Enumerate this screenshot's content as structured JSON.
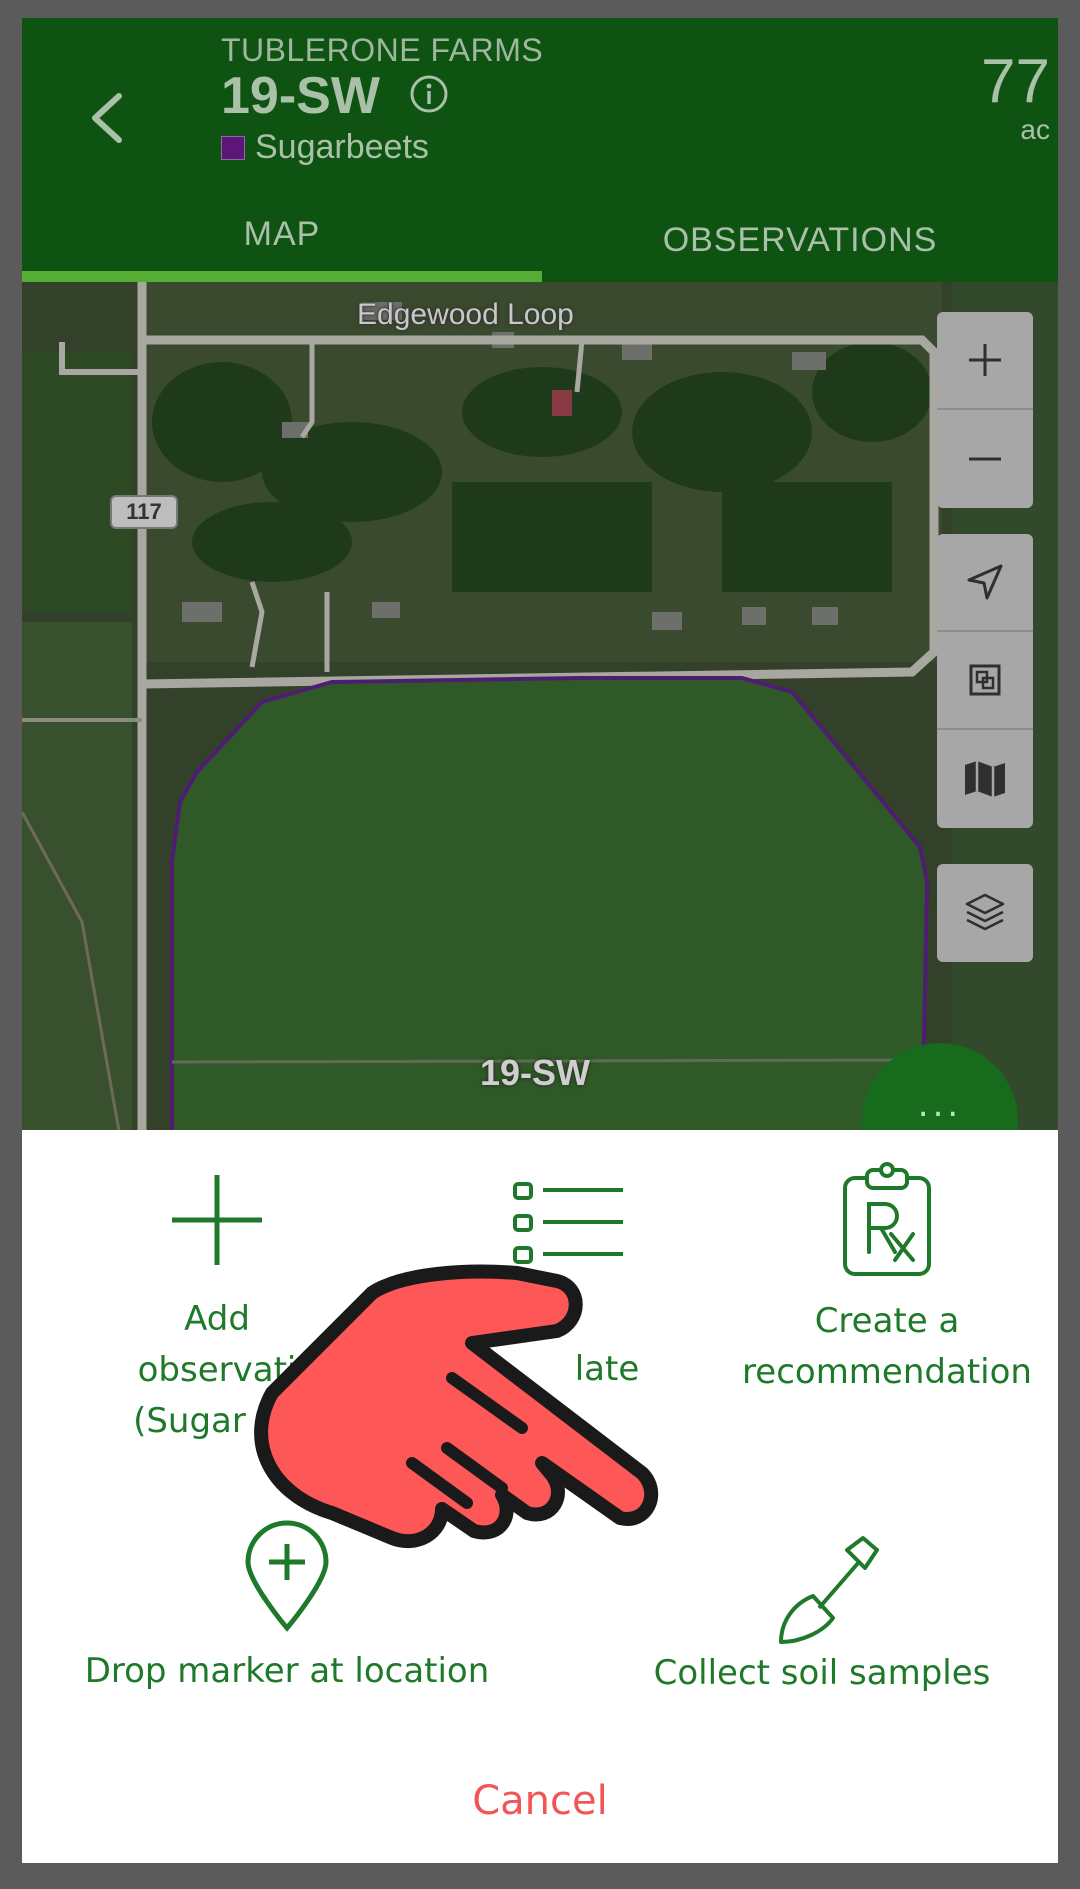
{
  "header": {
    "farm_name": "TUBLERONE FARMS",
    "field_name": "19-SW",
    "crop": "Sugarbeets",
    "crop_color": "#5a1778",
    "acres": "77",
    "acres_unit": "ac"
  },
  "tabs": [
    {
      "label": "MAP",
      "active": true
    },
    {
      "label": "OBSERVATIONS",
      "active": false
    }
  ],
  "map": {
    "road_label": "Edgewood Loop",
    "route_number": "117",
    "field_label": "19-SW",
    "boundary_color": "#4e1d73",
    "controls": [
      "plus-icon",
      "minus-icon",
      "navigation-arrow-icon",
      "fit-bounds-icon",
      "map-icon",
      "layers-icon"
    ],
    "fab_label": "..."
  },
  "actions": {
    "add_observation": "Add\nobservati\n(Sugar Be",
    "template_suffix": "late",
    "create_recommendation": "Create a\nrecommendation",
    "drop_marker": "Drop marker at location",
    "collect_soil": "Collect soil samples",
    "cancel": "Cancel"
  },
  "colors": {
    "header_bg": "#0f5313",
    "accent_green": "#56ad33",
    "action_green": "#1e7a2a",
    "cancel_red": "#f25555",
    "pointer_red": "#fe5757"
  }
}
